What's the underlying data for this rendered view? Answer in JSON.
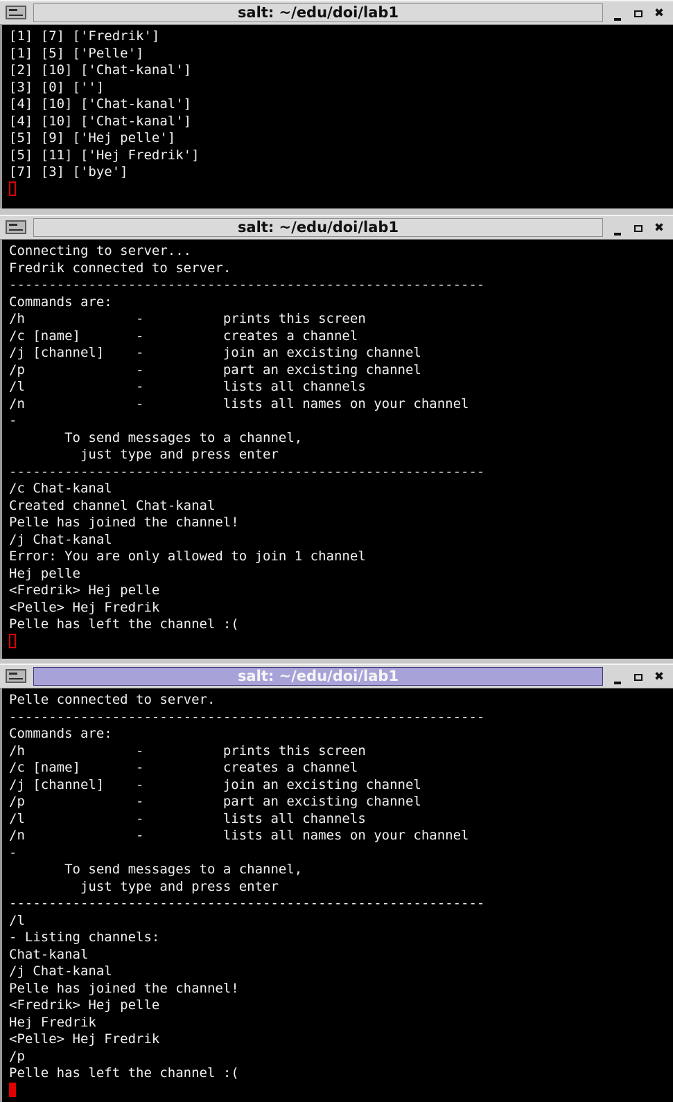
{
  "windows": [
    {
      "title": "salt: ~/edu/doi/lab1",
      "focused": false,
      "lines": [
        "[1] [7] ['Fredrik']",
        "[1] [5] ['Pelle']",
        "[2] [10] ['Chat-kanal']",
        "[3] [0] ['']",
        "[4] [10] ['Chat-kanal']",
        "[4] [10] ['Chat-kanal']",
        "[5] [9] ['Hej pelle']",
        "[5] [11] ['Hej Fredrik']",
        "[7] [3] ['bye']"
      ]
    },
    {
      "title": "salt: ~/edu/doi/lab1",
      "focused": false,
      "lines": [
        "Connecting to server...",
        "Fredrik connected to server.",
        "------------------------------------------------------------",
        "Commands are:",
        "/h              -          prints this screen",
        "/c [name]       -          creates a channel",
        "/j [channel]    -          join an excisting channel",
        "/p              -          part an excisting channel",
        "/l              -          lists all channels",
        "/n              -          lists all names on your channel",
        "-",
        "       To send messages to a channel,",
        "         just type and press enter",
        "------------------------------------------------------------",
        "/c Chat-kanal",
        "Created channel Chat-kanal",
        "Pelle has joined the channel!",
        "/j Chat-kanal",
        "Error: You are only allowed to join 1 channel",
        "Hej pelle",
        "<Fredrik> Hej pelle",
        "<Pelle> Hej Fredrik",
        "Pelle has left the channel :("
      ]
    },
    {
      "title": "salt: ~/edu/doi/lab1",
      "focused": true,
      "lines": [
        "Pelle connected to server.",
        "------------------------------------------------------------",
        "Commands are:",
        "/h              -          prints this screen",
        "/c [name]       -          creates a channel",
        "/j [channel]    -          join an excisting channel",
        "/p              -          part an excisting channel",
        "/l              -          lists all channels",
        "/n              -          lists all names on your channel",
        "-",
        "       To send messages to a channel,",
        "         just type and press enter",
        "------------------------------------------------------------",
        "/l",
        "- Listing channels:",
        "Chat-kanal",
        "/j Chat-kanal",
        "Pelle has joined the channel!",
        "<Fredrik> Hej pelle",
        "Hej Fredrik",
        "<Pelle> Hej Fredrik",
        "/p",
        "Pelle has left the channel :("
      ]
    }
  ],
  "colors": {
    "terminal_bg": "#000000",
    "terminal_fg": "#f0f0f0",
    "cursor": "#e00000",
    "active_title_bg": "#a7a2d8",
    "inactive_title_bg": "#dadada"
  },
  "icons": {
    "window_menu": "terminal-window-icon",
    "minimize": "minimize-icon",
    "maximize": "maximize-icon",
    "close": "close-icon"
  }
}
